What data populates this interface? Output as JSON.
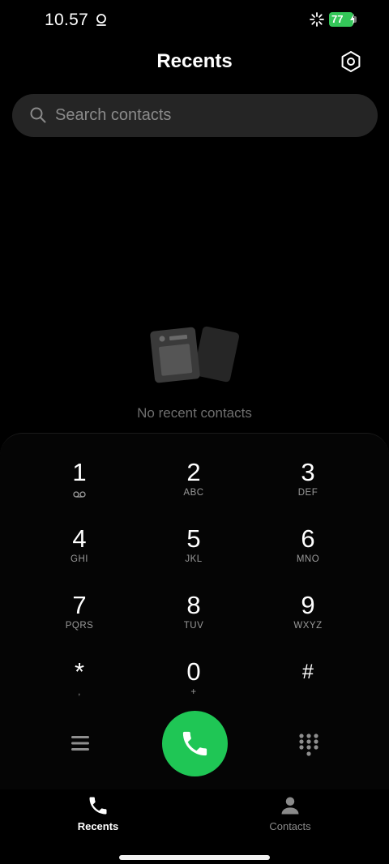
{
  "status_bar": {
    "time": "10.57",
    "battery_level": "77",
    "notification_icon": "alarm-icon",
    "signal_icon": "loading-icon",
    "battery_color": "#34c759"
  },
  "header": {
    "title": "Recents",
    "settings_icon": "settings-hexagon-icon"
  },
  "search": {
    "placeholder": "Search contacts",
    "icon": "search-icon"
  },
  "empty_state": {
    "icon": "contact-cards-icon",
    "message": "No recent contacts"
  },
  "dialpad": {
    "keys": [
      {
        "digit": "1",
        "letters": "",
        "sub_icon": "voicemail-icon"
      },
      {
        "digit": "2",
        "letters": "ABC"
      },
      {
        "digit": "3",
        "letters": "DEF"
      },
      {
        "digit": "4",
        "letters": "GHI"
      },
      {
        "digit": "5",
        "letters": "JKL"
      },
      {
        "digit": "6",
        "letters": "MNO"
      },
      {
        "digit": "7",
        "letters": "PQRS"
      },
      {
        "digit": "8",
        "letters": "TUV"
      },
      {
        "digit": "9",
        "letters": "WXYZ"
      },
      {
        "digit": "*",
        "letters": ","
      },
      {
        "digit": "0",
        "letters": "+"
      },
      {
        "digit": "#",
        "letters": ""
      }
    ],
    "menu_icon": "menu-icon",
    "call_icon": "phone-icon",
    "call_color": "#1fc655",
    "keypad_icon": "dialpad-icon"
  },
  "bottom_nav": {
    "items": [
      {
        "label": "Recents",
        "icon": "phone-icon",
        "active": true
      },
      {
        "label": "Contacts",
        "icon": "person-icon",
        "active": false
      }
    ]
  }
}
